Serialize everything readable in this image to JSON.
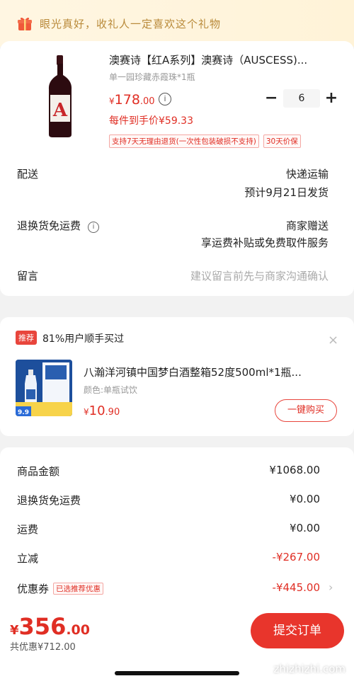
{
  "banner": {
    "text": "眼光真好，收礼人一定喜欢这个礼物",
    "icon": "gift-icon"
  },
  "product": {
    "title": "澳赛诗【红A系列】澳赛诗（AUSCESS)...",
    "spec": "单一园珍藏赤霞珠*1瓶",
    "price_yen": "¥",
    "price_int": "178",
    "price_dec": ".00",
    "info_icon": "ⓘ",
    "quantity": "6",
    "minus": "−",
    "plus": "+",
    "per_price": "每件到手价¥59.33",
    "tags": [
      "支持7天无理由退货(一次性包装破损不支持)",
      "30天价保"
    ],
    "label_letter": "A"
  },
  "delivery": {
    "label": "配送",
    "value": "快递运输",
    "eta": "预计9月21日发货"
  },
  "returns": {
    "label": "退换货免运费",
    "value": "商家赠送",
    "detail": "享运费补贴或免费取件服务"
  },
  "message": {
    "label": "留言",
    "placeholder": "建议留言前先与商家沟通确认"
  },
  "recommend": {
    "badge": "推荐",
    "title": "81%用户顺手买过",
    "close": "×",
    "name": "八瀚洋河镇中国梦白酒整箱52度500ml*1瓶...",
    "spec": "颜色:单瓶试饮",
    "price_yen": "¥",
    "price_int": "10",
    "price_dec": ".90",
    "img_tag": "9.9",
    "buy_label": "一键购买"
  },
  "summary": {
    "rows": [
      {
        "label": "商品金额",
        "value": "¥1068.00"
      },
      {
        "label": "退换货免运费",
        "value": "¥0.00"
      },
      {
        "label": "运费",
        "value": "¥0.00"
      },
      {
        "label": "立减",
        "value": "-¥267.00"
      },
      {
        "label": "优惠券",
        "value": "-¥445.00",
        "badge": "已选推荐优惠"
      }
    ],
    "chevron": "›"
  },
  "footer": {
    "total_yen": "¥",
    "total_int": "356",
    "total_dec": ".00",
    "saved": "共优惠¥712.00",
    "submit_label": "提交订单",
    "watermark": "zhizhizhi.com"
  },
  "colors": {
    "accent": "#e02e24",
    "banner_text": "#b98a3a",
    "banner_bg": "#fff6e2"
  }
}
